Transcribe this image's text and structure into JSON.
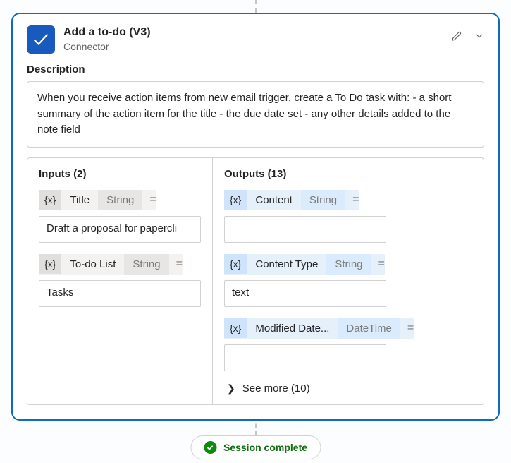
{
  "header": {
    "title": "Add a to-do (V3)",
    "subtitle": "Connector"
  },
  "description": {
    "label": "Description",
    "text": "When you receive action items from new email trigger, create a To Do task with: - a short summary of the action item for the title - the due date set - any other details added to the note field"
  },
  "inputs": {
    "heading": "Inputs (2)",
    "fx": "{x}",
    "items": [
      {
        "name": "Title",
        "type": "String",
        "equals": "=",
        "value": "Draft a proposal for papercli"
      },
      {
        "name": "To-do List",
        "type": "String",
        "equals": "=",
        "value": "Tasks"
      }
    ]
  },
  "outputs": {
    "heading": "Outputs (13)",
    "fx": "{x}",
    "items": [
      {
        "name": "Content",
        "type": "String",
        "equals": "=",
        "value": ""
      },
      {
        "name": "Content Type",
        "type": "String",
        "equals": "=",
        "value": "text"
      },
      {
        "name": "Modified Date...",
        "type": "DateTime",
        "equals": "=",
        "value": ""
      }
    ],
    "see_more": "See more (10)"
  },
  "status": {
    "text": "Session complete"
  }
}
